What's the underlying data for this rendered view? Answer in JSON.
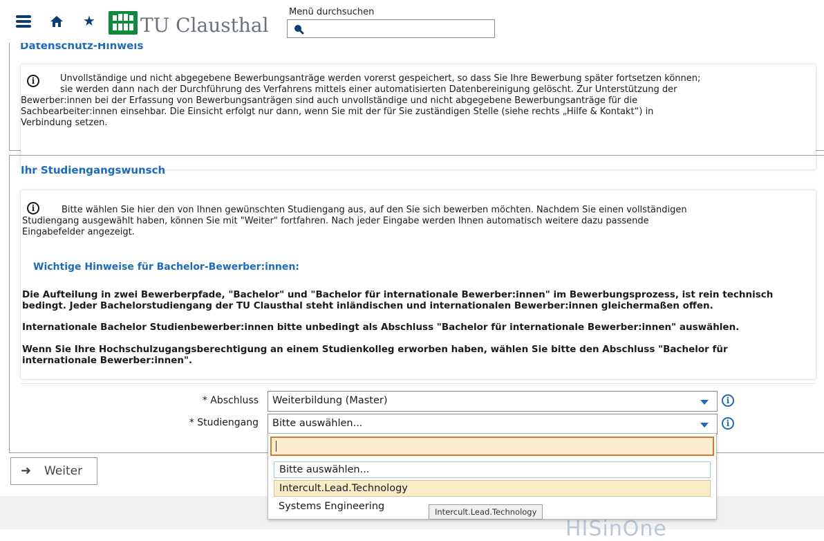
{
  "header": {
    "logo_text": "TU Clausthal",
    "search_label": "Menü durchsuchen",
    "search_value": ""
  },
  "privacy": {
    "title": "Datenschutz-Hinweis",
    "lines": [
      "Unvollständige und nicht abgegebene Bewerbungsanträge werden vorerst gespeichert, so dass Sie Ihre Bewerbung später fortsetzen können;",
      "sie werden dann nach der Durchführung des Verfahrens mittels einer automatisierten Datenbereinigung gelöscht. Zur Unterstützung der",
      "Bewerber:innen bei der Erfassung von Bewerbungsanträgen sind auch unvollständige und nicht abgegebene Bewerbungsanträge für die",
      "Sachbearbeiter:innen einsehbar. Die Einsicht erfolgt nur dann, wenn Sie mit der für Sie zuständigen Stelle (siehe rechts „Hilfe & Kontakt“) in",
      "Verbindung setzen."
    ]
  },
  "study": {
    "title": "Ihr Studiengangswunsch",
    "info_lines": [
      "Bitte wählen Sie hier den von Ihnen gewünschten Studiengang aus, auf den Sie sich bewerben möchten. Nachdem Sie einen vollständigen",
      "Studiengang ausgewählt haben, können Sie mit \"Weiter\" fortfahren. Nach jeder Eingabe werden Ihnen automatisch weitere dazu passende",
      "Eingabefelder angezeigt."
    ],
    "hint_heading": "Wichtige Hinweise für Bachelor-Bewerber:innen:",
    "para1_lines": [
      "Die Aufteilung in zwei Bewerberpfade, \"Bachelor\" und \"Bachelor für internationale Bewerber:innen\" im Bewerbungsprozess, ist rein technisch",
      "bedingt. Jeder Bachelorstudiengang der TU Clausthal steht inländischen und internationalen Bewerber:innen gleichermaßen offen."
    ],
    "para2": "Internationale Bachelor Studienbewerber:innen bitte unbedingt als Abschluss \"Bachelor für internationale Bewerber:innen\" auswählen.",
    "para3_lines": [
      "Wenn Sie Ihre Hochschulzugangsberechtigung an einem Studienkolleg erworben haben, wählen Sie bitte den Abschluss \"Bachelor für",
      "internationale Bewerber:innen\"."
    ]
  },
  "form": {
    "abschluss_label": "* Abschluss",
    "abschluss_value": "Weiterbildung (Master)",
    "studiengang_label": "* Studiengang",
    "studiengang_value": "Bitte auswählen..."
  },
  "dropdown": {
    "search_value": "",
    "options": [
      "Bitte auswählen...",
      "Intercult.Lead.Technology",
      "Systems Engineering"
    ],
    "highlighted": "Intercult.Lead.Technology",
    "tooltip": "Intercult.Lead.Technology"
  },
  "buttons": {
    "weiter": "Weiter"
  },
  "footer": {
    "logo_text": "HISinOne"
  },
  "colors": {
    "link_blue": "#1e6bb8",
    "nav_blue": "#0c3d72",
    "logo_green": "#0f8a3c",
    "focus_orange": "#d9792d",
    "highlight": "#fbecc8"
  }
}
